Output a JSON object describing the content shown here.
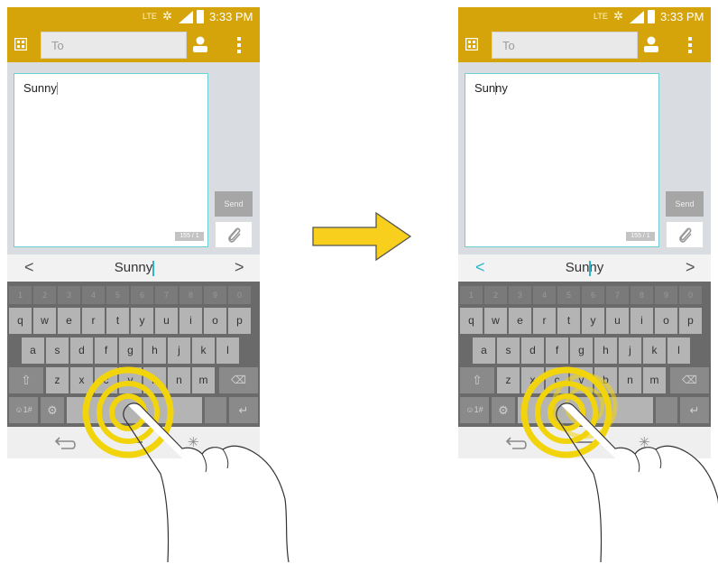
{
  "status_bar": {
    "network": "LTE",
    "time": "3:33 PM"
  },
  "action_bar": {
    "to_placeholder": "To"
  },
  "message": {
    "text": "Sunny",
    "counter": "155 / 1"
  },
  "buttons": {
    "send": "Send"
  },
  "suggestion": {
    "word": "Sunny"
  },
  "keyboard": {
    "numbers": [
      "1",
      "2",
      "3",
      "4",
      "5",
      "6",
      "7",
      "8",
      "9",
      "0"
    ],
    "row1": [
      "q",
      "w",
      "e",
      "r",
      "t",
      "y",
      "u",
      "i",
      "o",
      "p"
    ],
    "row2": [
      "a",
      "s",
      "d",
      "f",
      "g",
      "h",
      "j",
      "k",
      "l"
    ],
    "row3": [
      "z",
      "x",
      "c",
      "v",
      "b",
      "n",
      "m"
    ],
    "sym_label": "☺1#"
  },
  "icons": {
    "compose": "compose-icon",
    "contact": "contact-icon",
    "menu": "overflow-menu-icon",
    "attach": "paperclip-icon",
    "shift": "shift-icon",
    "backspace": "backspace-icon",
    "settings": "gear-icon",
    "enter": "enter-icon",
    "back": "back-icon",
    "home": "home-icon",
    "recent": "recent-apps-icon",
    "transition": "arrow-right-icon"
  },
  "colors": {
    "header": "#d5a40a",
    "accent": "#2ab7c9",
    "gesture": "#f2d40c"
  }
}
